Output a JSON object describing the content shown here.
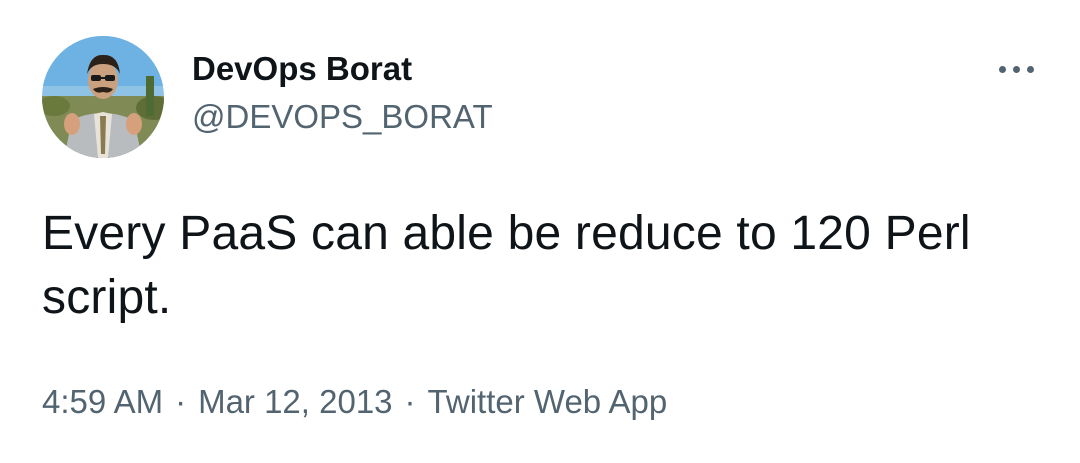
{
  "author": {
    "display_name": "DevOps Borat",
    "handle": "@DEVOPS_BORAT",
    "avatar": "profile-photo-man-in-grey-suit-thumbs-up"
  },
  "more_menu_icon": "more-horizontal-icon",
  "tweet": {
    "text": "Every PaaS can able be reduce to 120 Perl script."
  },
  "meta": {
    "time": "4:59 AM",
    "separator": "·",
    "date": "Mar 12, 2013",
    "source": "Twitter Web App"
  },
  "colors": {
    "text_primary": "#0f1419",
    "text_secondary": "#536471",
    "background": "#ffffff"
  }
}
